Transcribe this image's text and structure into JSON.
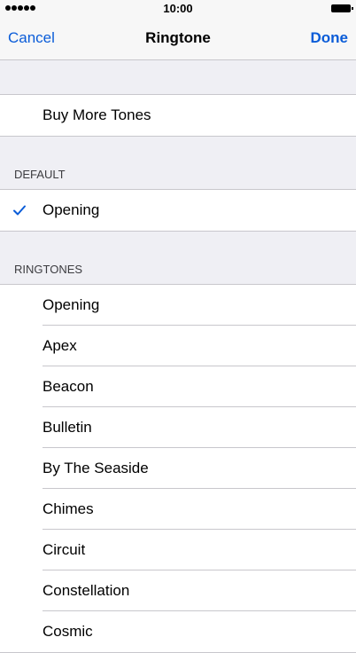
{
  "status": {
    "time": "10:00"
  },
  "nav": {
    "cancel": "Cancel",
    "title": "Ringtone",
    "done": "Done"
  },
  "store": {
    "label": "Buy More Tones"
  },
  "default_section": {
    "header": "DEFAULT",
    "selected": "Opening"
  },
  "ringtones_section": {
    "header": "RINGTONES",
    "items": [
      "Opening",
      "Apex",
      "Beacon",
      "Bulletin",
      "By The Seaside",
      "Chimes",
      "Circuit",
      "Constellation",
      "Cosmic"
    ]
  },
  "colors": {
    "accent": "#0a5cd8",
    "background": "#efeff4",
    "separator": "#c8c7cc"
  }
}
